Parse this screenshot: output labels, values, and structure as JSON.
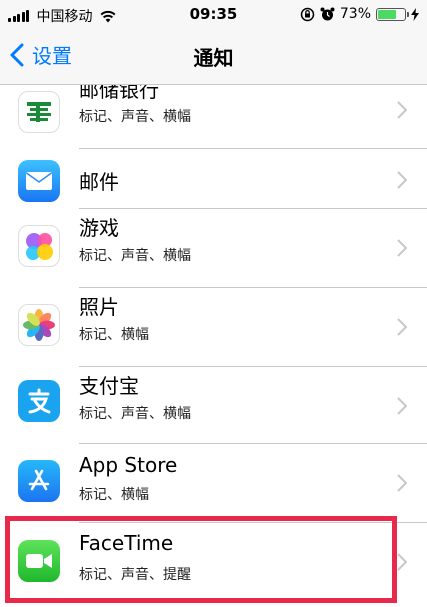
{
  "status_bar": {
    "carrier": "中国移动",
    "time": "09:35",
    "battery_percent_label": "73%",
    "battery_level": 0.73
  },
  "nav": {
    "back_label": "设置",
    "title": "通知"
  },
  "apps": [
    {
      "name": "邮储银行",
      "subtitle": "标记、声音、横幅",
      "icon": "psbc-bank-icon"
    },
    {
      "name": "邮件",
      "subtitle": "",
      "icon": "mail-icon"
    },
    {
      "name": "游戏",
      "subtitle": "标记、声音、横幅",
      "icon": "game-center-icon"
    },
    {
      "name": "照片",
      "subtitle": "标记、横幅",
      "icon": "photos-icon"
    },
    {
      "name": "支付宝",
      "subtitle": "标记、声音、横幅",
      "icon": "alipay-icon"
    },
    {
      "name": "App Store",
      "subtitle": "标记、横幅",
      "icon": "app-store-icon"
    },
    {
      "name": "FaceTime",
      "subtitle": "标记、声音、提醒",
      "icon": "facetime-icon"
    }
  ],
  "colors": {
    "accent": "#007aff",
    "highlight_border": "#e8294c"
  }
}
